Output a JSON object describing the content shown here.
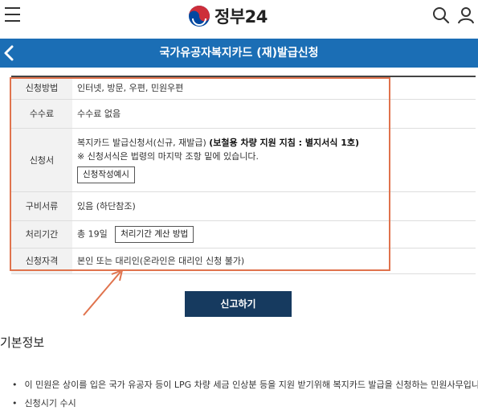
{
  "header": {
    "logo_text": "정부24"
  },
  "page": {
    "title": "국가유공자복지카드 (재)발급신청"
  },
  "table": {
    "rows": [
      {
        "label": "신청방법",
        "value": "인터넷, 방문, 우편, 민원우편"
      },
      {
        "label": "수수료",
        "value": "수수료 없음"
      },
      {
        "label": "신청서",
        "value_prefix": "복지카드 발급신청서(신규, 재발급) ",
        "value_bold": "(보철용 차량 지원 지침 : 별지서식 1호)",
        "note": "※ 신청서식은 법령의 마지막 조항 밑에 있습니다.",
        "button": "신청작성예시"
      },
      {
        "label": "구비서류",
        "value": "있음 (하단참조)"
      },
      {
        "label": "처리기간",
        "value": "총 19일",
        "button": "처리기간 계산 방법"
      },
      {
        "label": "신청자격",
        "value": "본인 또는 대리인(온라인은 대리인 신청 불가)"
      }
    ]
  },
  "actions": {
    "submit_label": "신고하기"
  },
  "basic_info": {
    "title": "기본정보",
    "items": [
      "이 민원은 상이를 입은 국가 유공자 등이 LPG 차량 세금 인상분 등을 지원 받기위해 복지카드 발급을 신청하는 민원사무입니다",
      "신청시기 수시"
    ]
  },
  "colors": {
    "title_bar": "#1b6eb5",
    "submit_button": "#163a5f",
    "highlight": "#e0734d",
    "logo_red": "#cd2e3a",
    "logo_blue": "#0047a0"
  },
  "icons": [
    "hamburger-menu-icon",
    "search-icon",
    "user-icon",
    "back-arrow-icon",
    "annotation-arrow"
  ]
}
